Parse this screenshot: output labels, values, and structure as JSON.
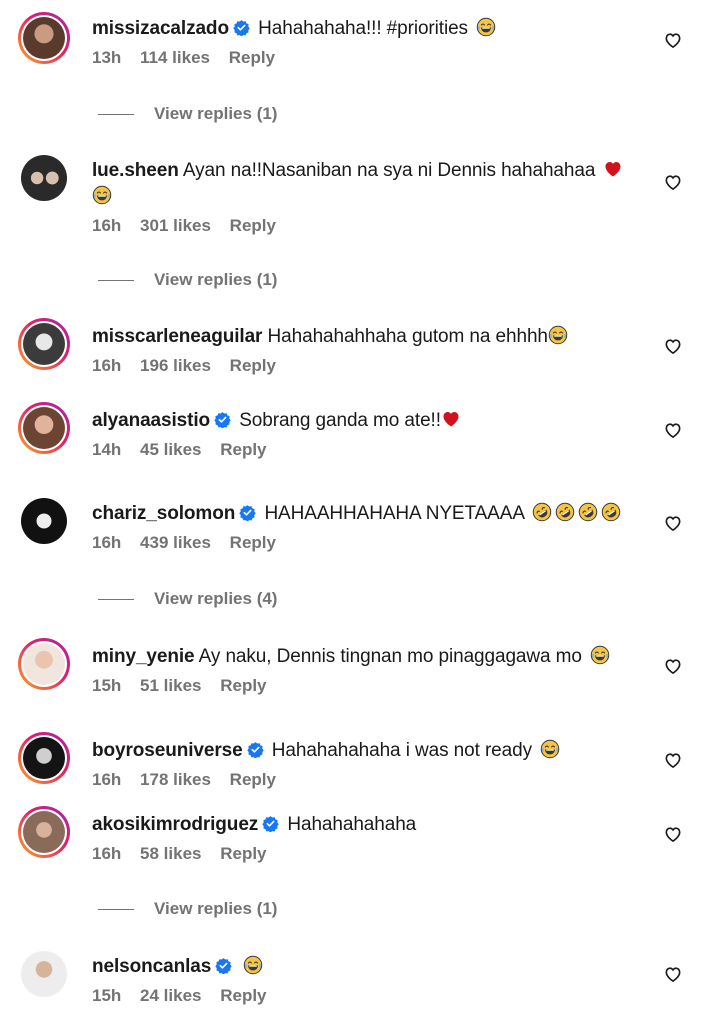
{
  "icons": {
    "verified": "verified-badge-icon",
    "like": "heart-outline-icon",
    "laugh": "tears-of-joy-emoji",
    "rofl": "rolling-laughing-emoji",
    "heart": "red-heart-emoji"
  },
  "colors": {
    "verified": "#1877f2",
    "meta": "#737373",
    "heart_red": "#d1121d",
    "emoji_yellow": "#f6c443"
  },
  "comments": [
    {
      "username": "missizacalzado",
      "verified": true,
      "text": "Hahahahaha!!! #priorities",
      "time": "13h",
      "likes": "114 likes",
      "reply": "Reply",
      "view_replies": "View replies (1)"
    },
    {
      "username": "lue.sheen",
      "verified": false,
      "text": "Ayan na!!Nasaniban na sya ni Dennis hahahahaa",
      "time": "16h",
      "likes": "301 likes",
      "reply": "Reply",
      "view_replies": "View replies (1)"
    },
    {
      "username": "misscarleneaguilar",
      "verified": false,
      "text": "Hahahahahhaha gutom na ehhhh",
      "time": "16h",
      "likes": "196 likes",
      "reply": "Reply"
    },
    {
      "username": "alyanaasistio",
      "verified": true,
      "text": "Sobrang ganda mo ate!!",
      "time": "14h",
      "likes": "45 likes",
      "reply": "Reply"
    },
    {
      "username": "chariz_solomon",
      "verified": true,
      "text": "HAHAAHHAHAHA NYETAAAA",
      "time": "16h",
      "likes": "439 likes",
      "reply": "Reply",
      "view_replies": "View replies (4)"
    },
    {
      "username": "miny_yenie",
      "verified": false,
      "text": "Ay naku, Dennis tingnan mo pinaggagawa mo",
      "time": "15h",
      "likes": "51 likes",
      "reply": "Reply"
    },
    {
      "username": "boyroseuniverse",
      "verified": true,
      "text": "Hahahahahaha i was not ready",
      "time": "16h",
      "likes": "178 likes",
      "reply": "Reply"
    },
    {
      "username": "akosikimrodriguez",
      "verified": true,
      "text": "Hahahahahaha",
      "time": "16h",
      "likes": "58 likes",
      "reply": "Reply",
      "view_replies": "View replies (1)"
    },
    {
      "username": "nelsoncanlas",
      "verified": true,
      "text": "",
      "time": "15h",
      "likes": "24 likes",
      "reply": "Reply"
    }
  ]
}
